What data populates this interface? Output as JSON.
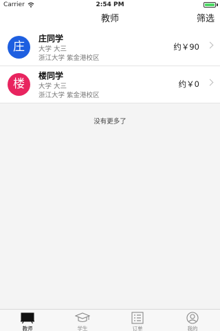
{
  "status_bar": {
    "carrier": "Carrier",
    "time": "2:54 PM",
    "battery_level": 1.0,
    "wifi_icon": "wifi-icon",
    "battery_icon": "battery-icon"
  },
  "nav": {
    "title": "教师",
    "filter_label": "筛选"
  },
  "teachers": [
    {
      "avatar_char": "庄",
      "avatar_color": "#1e5fe0",
      "name": "庄同学",
      "level": "大学 大三",
      "school": "浙江大学 紫金港校区",
      "price": "约￥90"
    },
    {
      "avatar_char": "楼",
      "avatar_color": "#e8245f",
      "name": "楼同学",
      "level": "大学 大三",
      "school": "浙江大学 紫金港校区",
      "price": "约￥0"
    }
  ],
  "list_footer": "没有更多了",
  "tabs": [
    {
      "label": "教师",
      "icon": "blackboard-icon",
      "active": true
    },
    {
      "label": "学生",
      "icon": "graduation-cap-icon",
      "active": false
    },
    {
      "label": "订单",
      "icon": "order-list-icon",
      "active": false
    },
    {
      "label": "我的",
      "icon": "profile-icon",
      "active": false
    }
  ],
  "colors": {
    "accent_blue": "#1e5fe0",
    "accent_pink": "#e8245f",
    "battery_green": "#4cd964"
  }
}
